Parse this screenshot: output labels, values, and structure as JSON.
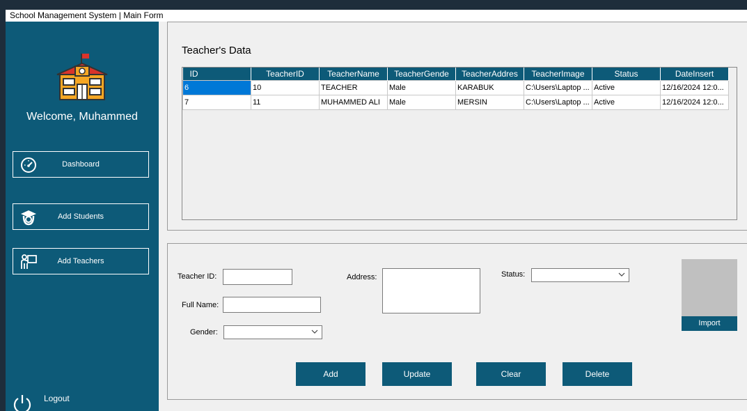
{
  "window": {
    "title": "School Management System | Main Form"
  },
  "sidebar": {
    "welcome": "Welcome, Muhammed",
    "items": [
      {
        "label": "Dashboard",
        "icon": "dashboard-gauge-icon"
      },
      {
        "label": "Add Students",
        "icon": "student-icon"
      },
      {
        "label": "Add Teachers",
        "icon": "teacher-icon"
      }
    ],
    "logout": "Logout"
  },
  "teachers_panel": {
    "title": "Teacher's Data",
    "columns": [
      "ID",
      "TeacherID",
      "TeacherName",
      "TeacherGende",
      "TeacherAddres",
      "TeacherImage",
      "Status",
      "DateInsert"
    ],
    "rows": [
      [
        "6",
        "10",
        "TEACHER",
        "Male",
        "KARABUK",
        "C:\\Users\\Laptop ...",
        "Active",
        "12/16/2024 12:0..."
      ],
      [
        "7",
        "11",
        "MUHAMMED ALI",
        "Male",
        "MERSIN",
        "C:\\Users\\Laptop ...",
        "Active",
        "12/16/2024 12:0..."
      ]
    ]
  },
  "form": {
    "teacher_id_label": "Teacher ID:",
    "full_name_label": "Full Name:",
    "gender_label": "Gender:",
    "address_label": "Address:",
    "status_label": "Status:",
    "teacher_id_value": "",
    "full_name_value": "",
    "gender_value": "",
    "address_value": "",
    "status_value": "",
    "import_label": "Import",
    "add_label": "Add",
    "update_label": "Update",
    "clear_label": "Clear",
    "delete_label": "Delete"
  },
  "colors": {
    "sidebar": "#0d5a78",
    "accent": "#0d5a78",
    "selection": "#0078d7"
  }
}
